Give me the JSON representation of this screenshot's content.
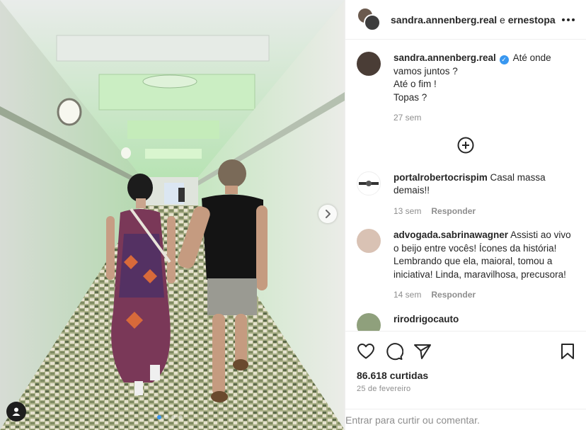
{
  "post": {
    "header_users": "sandra.annenberg.real",
    "header_connector": " e ",
    "header_coauthor": "ernestopa",
    "caption": {
      "username": "sandra.annenberg.real",
      "verified_glyph": "✓",
      "line1": "Até onde vamos juntos ?",
      "line2": "Até o fim !",
      "line3": "Topas ?",
      "time": "27 sem"
    },
    "comments": [
      {
        "username": "portalrobertocrispim",
        "text": "Casal massa demais!!",
        "time": "13 sem",
        "reply": "Responder",
        "avatar_color": "#ffffff"
      },
      {
        "username": "advogada.sabrinawagner",
        "text": "Assisti ao vivo o beijo entre vocês! Ícones da história! Lembrando que ela, maioral, tomou a iniciativa! Linda, maravilhosa, precusora!",
        "time": "14 sem",
        "reply": "Responder",
        "avatar_color": "#d9c2b4"
      },
      {
        "username": "rirodrigocauto",
        "text": "",
        "time": "",
        "reply": "",
        "avatar_color": "#8fa07c"
      }
    ],
    "likes": "86.618 curtidas",
    "date": "25 de fevereiro",
    "login_link": "Entrar",
    "login_rest": " para curtir ou comentar.",
    "carousel": {
      "total": 4,
      "current": 1
    }
  },
  "colors": {
    "accent": "#3897f0",
    "text": "#262626",
    "muted": "#8e8e8e",
    "border": "#efefef"
  },
  "icons": [
    "more-icon",
    "add-circle-icon",
    "heart-icon",
    "comment-icon",
    "share-icon",
    "save-icon",
    "chevron-right-icon",
    "user-tag-icon",
    "verified-icon"
  ]
}
